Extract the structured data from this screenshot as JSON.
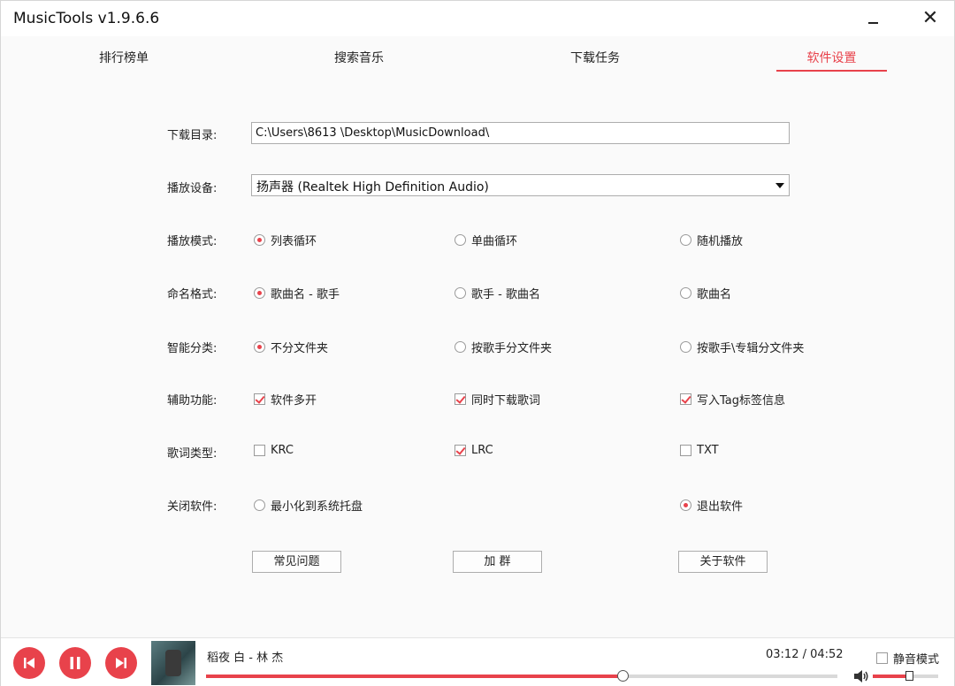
{
  "window": {
    "title": "MusicTools v1.9.6.6",
    "minimize_label": "",
    "close_label": "✕"
  },
  "tabs": [
    {
      "label": "排行榜单",
      "active": false
    },
    {
      "label": "搜索音乐",
      "active": false
    },
    {
      "label": "下载任务",
      "active": false
    },
    {
      "label": "软件设置",
      "active": true
    }
  ],
  "settings": {
    "download_dir": {
      "label": "下载目录:",
      "value": "C:\\Users\\8613  \\Desktop\\MusicDownload\\"
    },
    "play_device": {
      "label": "播放设备:",
      "value": "扬声器 (Realtek High Definition Audio)"
    },
    "play_mode": {
      "label": "播放模式:",
      "options": [
        "列表循环",
        "单曲循环",
        "随机播放"
      ],
      "selected": 0
    },
    "naming": {
      "label": "命名格式:",
      "options": [
        "歌曲名 - 歌手",
        "歌手 - 歌曲名",
        "歌曲名"
      ],
      "selected": 0
    },
    "classify": {
      "label": "智能分类:",
      "options": [
        "不分文件夹",
        "按歌手分文件夹",
        "按歌手\\专辑分文件夹"
      ],
      "selected": 0
    },
    "aux": {
      "label": "辅助功能:",
      "options": [
        "软件多开",
        "同时下载歌词",
        "写入Tag标签信息"
      ],
      "checked": [
        true,
        true,
        true
      ]
    },
    "lyric_type": {
      "label": "歌词类型:",
      "options": [
        "KRC",
        "LRC",
        "TXT"
      ],
      "checked": [
        false,
        true,
        false
      ]
    },
    "close": {
      "label": "关闭软件:",
      "options": [
        "最小化到系统托盘",
        "退出软件"
      ],
      "selected": 1
    }
  },
  "buttons": {
    "faq": "常见问题",
    "group": "加 群",
    "about": "关于软件"
  },
  "player": {
    "song": "稻夜 白 - 林 杰",
    "time": "03:12 / 04:52",
    "progress": 0.66,
    "volume": 0.55,
    "mute_label": "静音模式",
    "mute_checked": false,
    "accent": "#e8424b"
  }
}
